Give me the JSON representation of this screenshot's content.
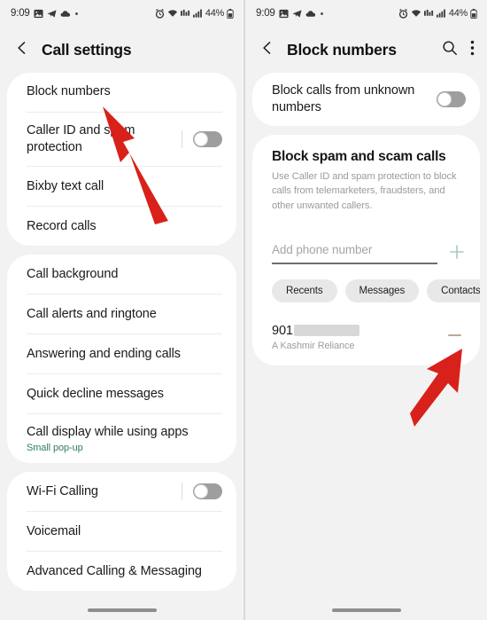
{
  "status_bar": {
    "time": "9:09",
    "left_icons": [
      "photo-icon",
      "telegram-icon",
      "cloud-icon",
      "dot-icon"
    ],
    "right_icons": [
      "alarm-icon",
      "wifi-icon",
      "mobile-data-icon",
      "signal-icon"
    ],
    "battery_percent": "44%",
    "battery_icon": "battery-icon"
  },
  "left_screen": {
    "appbar": {
      "back_icon": "back-chevron-icon",
      "title": "Call settings"
    },
    "groups": [
      {
        "items": [
          {
            "title": "Block numbers",
            "toggle": null,
            "subtitle": null
          },
          {
            "title": "Caller ID and spam protection",
            "toggle": "off",
            "subtitle": null
          },
          {
            "title": "Bixby text call",
            "toggle": null,
            "subtitle": null
          },
          {
            "title": "Record calls",
            "toggle": null,
            "subtitle": null
          }
        ]
      },
      {
        "items": [
          {
            "title": "Call background",
            "toggle": null,
            "subtitle": null
          },
          {
            "title": "Call alerts and ringtone",
            "toggle": null,
            "subtitle": null
          },
          {
            "title": "Answering and ending calls",
            "toggle": null,
            "subtitle": null
          },
          {
            "title": "Quick decline messages",
            "toggle": null,
            "subtitle": null
          },
          {
            "title": "Call display while using apps",
            "toggle": null,
            "subtitle": "Small pop-up"
          }
        ]
      },
      {
        "items": [
          {
            "title": "Wi-Fi Calling",
            "toggle": "off",
            "subtitle": null
          },
          {
            "title": "Voicemail",
            "toggle": null,
            "subtitle": null
          },
          {
            "title": "Advanced Calling & Messaging",
            "toggle": null,
            "subtitle": null
          }
        ]
      }
    ]
  },
  "right_screen": {
    "appbar": {
      "back_icon": "back-chevron-icon",
      "title": "Block numbers",
      "search_icon": "search-icon",
      "overflow_icon": "more-options-icon"
    },
    "unknown_numbers": {
      "title": "Block calls from unknown numbers",
      "toggle": "off"
    },
    "spam_info": {
      "title": "Block spam and scam calls",
      "description": "Use Caller ID and spam protection to block calls from telemarketers, fraudsters, and other unwanted callers."
    },
    "add_number": {
      "placeholder": "Add phone number",
      "value": "",
      "add_icon": "plus-icon"
    },
    "source_chips": [
      "Recents",
      "Messages",
      "Contacts"
    ],
    "blocked_list": [
      {
        "number_prefix": "901",
        "number_redacted": true,
        "label": "A Kashmir Reliance",
        "remove_icon": "minus-icon"
      }
    ]
  },
  "annotations": {
    "arrow_color": "#d8211a",
    "arrows": [
      {
        "name": "arrow-to-block-numbers",
        "panel": "left"
      },
      {
        "name": "arrow-to-remove-blocked-number",
        "panel": "right"
      }
    ]
  },
  "nav_bar": {
    "pill": "home-gesture-pill"
  },
  "colors": {
    "background": "#f2f2f2",
    "card": "#ffffff",
    "accent_green": "#2e7d62",
    "arrow_red": "#d8211a"
  }
}
